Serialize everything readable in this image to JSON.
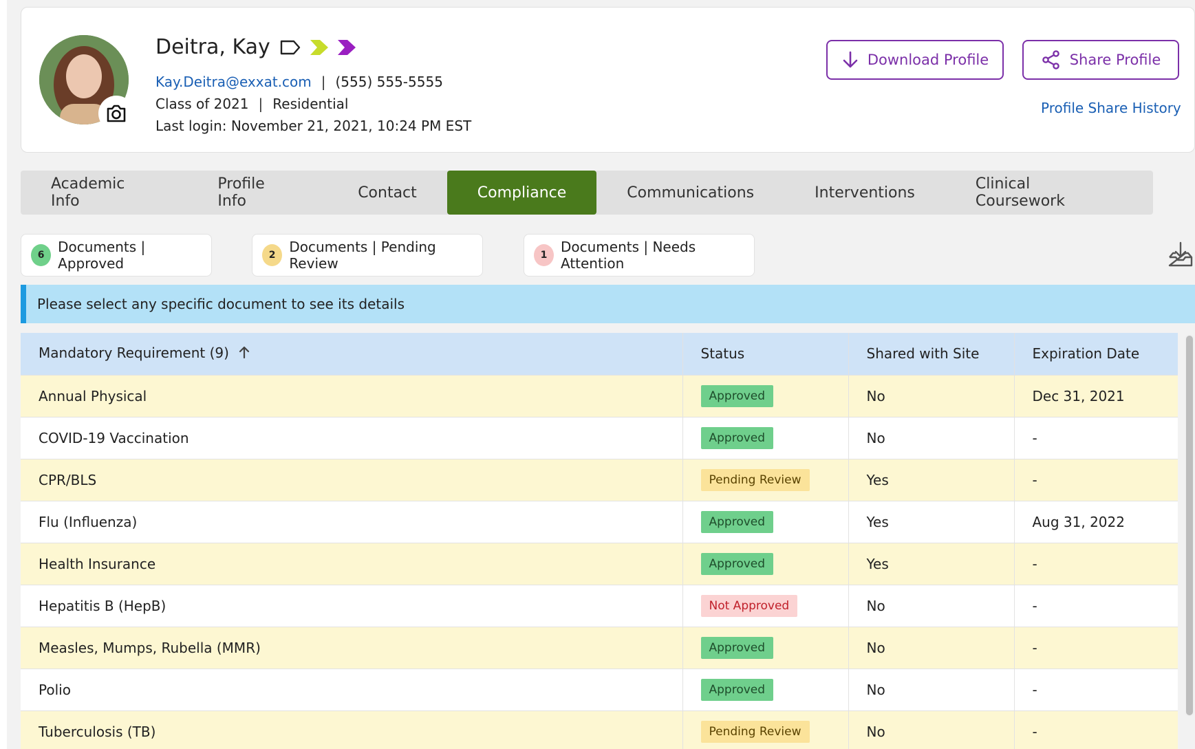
{
  "profile": {
    "name": "Deitra, Kay",
    "email": "Kay.Deitra@exxat.com",
    "phone": "(555) 555-5555",
    "class": "Class of 2021",
    "program": "Residential",
    "last_login": "Last login: November 21, 2021, 10:24 PM EST",
    "separator": "|",
    "tag_icon": "tag-outline-icon",
    "chevron_colors": [
      "#c7dc2b",
      "#9a1fc1"
    ]
  },
  "actions": {
    "download_label": "Download Profile",
    "share_label": "Share Profile",
    "share_history_label": "Profile Share History",
    "accent": "#7b2fa8"
  },
  "tabs": [
    {
      "label": "Academic Info"
    },
    {
      "label": "Profile Info"
    },
    {
      "label": "Contact"
    },
    {
      "label": "Compliance",
      "active": true
    },
    {
      "label": "Communications"
    },
    {
      "label": "Interventions"
    },
    {
      "label": "Clinical Coursework"
    }
  ],
  "summary": {
    "approved": {
      "count": "6",
      "label": "Documents | Approved"
    },
    "pending": {
      "count": "2",
      "label": "Documents | Pending Review"
    },
    "attention": {
      "count": "1",
      "label": "Documents | Needs Attention"
    }
  },
  "banner": {
    "text": "Please select any specific document to see its details"
  },
  "table": {
    "headers": [
      "Mandatory Requirement (9)",
      "Status",
      "Shared with Site",
      "Expiration Date"
    ],
    "rows": [
      {
        "requirement": "Annual Physical",
        "status": "Approved",
        "status_type": "approved",
        "shared": "No",
        "expiration": "Dec 31, 2021"
      },
      {
        "requirement": "COVID-19 Vaccination",
        "status": "Approved",
        "status_type": "approved",
        "shared": "No",
        "expiration": "-"
      },
      {
        "requirement": "CPR/BLS",
        "status": "Pending Review",
        "status_type": "pending",
        "shared": "Yes",
        "expiration": "-"
      },
      {
        "requirement": "Flu (Influenza)",
        "status": "Approved",
        "status_type": "approved",
        "shared": "Yes",
        "expiration": "Aug 31, 2022"
      },
      {
        "requirement": "Health Insurance",
        "status": "Approved",
        "status_type": "approved",
        "shared": "Yes",
        "expiration": "-"
      },
      {
        "requirement": "Hepatitis B (HepB)",
        "status": "Not Approved",
        "status_type": "not-approved",
        "shared": "No",
        "expiration": "-"
      },
      {
        "requirement": "Measles, Mumps, Rubella (MMR)",
        "status": "Approved",
        "status_type": "approved",
        "shared": "No",
        "expiration": "-"
      },
      {
        "requirement": "Polio",
        "status": "Approved",
        "status_type": "approved",
        "shared": "No",
        "expiration": "-"
      },
      {
        "requirement": "Tuberculosis (TB)",
        "status": "Pending Review",
        "status_type": "pending",
        "shared": "No",
        "expiration": "-"
      }
    ]
  }
}
